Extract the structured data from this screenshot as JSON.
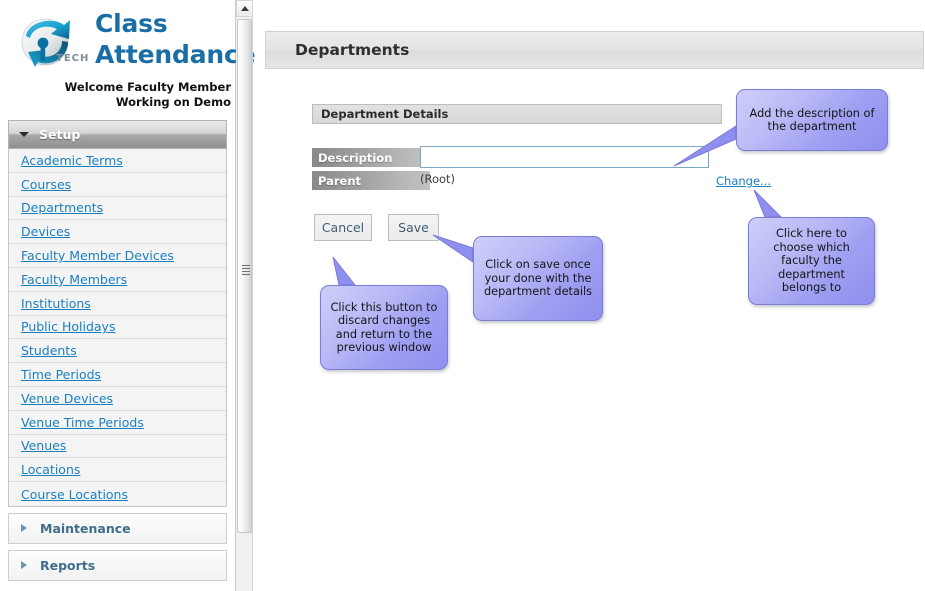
{
  "brand": {
    "logo_icon": "globe-swoosh-logo",
    "logo_text": "TECH",
    "title_line1": "Class",
    "title_line2": "Attendance",
    "welcome_line1": "Welcome Faculty Member",
    "welcome_line2": "Working on Demo",
    "accent_color": "#1b6ea5"
  },
  "sidebar": {
    "setup": {
      "label": "Setup",
      "expanded": true,
      "icon": "chevron-down-icon"
    },
    "items": [
      {
        "label": "Academic Terms"
      },
      {
        "label": "Courses"
      },
      {
        "label": "Departments"
      },
      {
        "label": "Devices"
      },
      {
        "label": "Faculty Member Devices"
      },
      {
        "label": "Faculty Members"
      },
      {
        "label": "Institutions"
      },
      {
        "label": "Public Holidays"
      },
      {
        "label": "Students"
      },
      {
        "label": "Time Periods"
      },
      {
        "label": "Venue Devices"
      },
      {
        "label": "Venue Time Periods"
      },
      {
        "label": "Venues"
      },
      {
        "label": "Locations"
      },
      {
        "label": "Course Locations"
      }
    ],
    "maintenance": {
      "label": "Maintenance",
      "icon": "chevron-right-icon"
    },
    "reports": {
      "label": "Reports",
      "icon": "chevron-right-icon"
    },
    "link_color": "#1b7fbf"
  },
  "scrollbar": {
    "up_arrow_icon": "caret-up-icon",
    "grip_icon": "grip-lines-icon"
  },
  "main": {
    "page_title": "Departments",
    "panel": {
      "header": "Department Details",
      "fields": {
        "description": {
          "label": "Description",
          "value": "",
          "placeholder": ""
        },
        "parent": {
          "label": "Parent",
          "value": "(Root)",
          "change_link": "Change..."
        }
      }
    },
    "buttons": {
      "cancel": "Cancel",
      "save": "Save"
    }
  },
  "callouts": {
    "description": "Add the description of the department",
    "change": "Click here to choose which faculty the department belongs to",
    "save": "Click on save once your done with the department details",
    "cancel": "Click this button to discard changes and return to the previous window",
    "fill_color": "#9f9ff2",
    "border_color": "#7b7bd8"
  }
}
